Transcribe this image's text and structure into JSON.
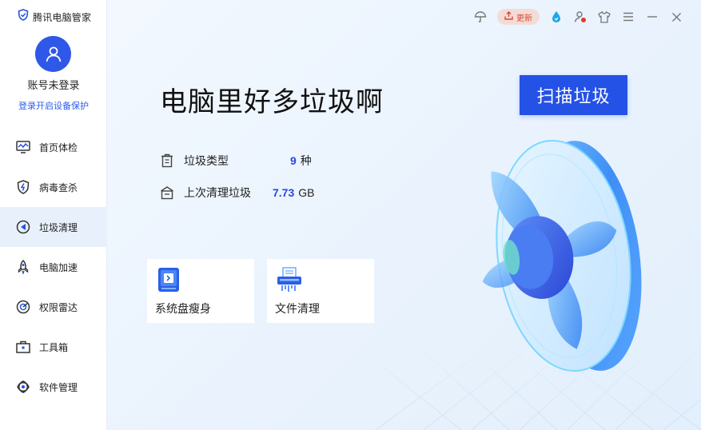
{
  "app": {
    "title": "腾讯电脑管家"
  },
  "account": {
    "name": "账号未登录",
    "login_link": "登录开启设备保护"
  },
  "sidebar": {
    "items": [
      {
        "label": "首页体检",
        "icon": "monitor-check-icon"
      },
      {
        "label": "病毒查杀",
        "icon": "shield-flash-icon"
      },
      {
        "label": "垃圾清理",
        "icon": "cleanup-icon",
        "active": true
      },
      {
        "label": "电脑加速",
        "icon": "rocket-icon"
      },
      {
        "label": "权限雷达",
        "icon": "radar-icon"
      },
      {
        "label": "工具箱",
        "icon": "toolbox-icon"
      },
      {
        "label": "软件管理",
        "icon": "software-icon"
      }
    ]
  },
  "topbar": {
    "update_label": "更新",
    "icons": [
      "umbrella-icon",
      "update-icon",
      "droplet-icon",
      "user-alert-icon",
      "skin-icon",
      "menu-icon",
      "minimize-icon",
      "close-icon"
    ]
  },
  "main": {
    "headline": "电脑里好多垃圾啊",
    "scan_button": "扫描垃圾",
    "stats": [
      {
        "label": "垃圾类型",
        "value": "9",
        "unit": "种"
      },
      {
        "label": "上次清理垃圾",
        "value": "7.73",
        "unit": "GB"
      }
    ],
    "tools": [
      {
        "label": "系统盘瘦身",
        "icon": "disk-slim-icon"
      },
      {
        "label": "文件清理",
        "icon": "file-shredder-icon"
      }
    ]
  },
  "colors": {
    "accent": "#2451e6",
    "stat_value": "#2349e0",
    "update_text": "#e0472b",
    "active_nav": "#e8f0fb"
  }
}
